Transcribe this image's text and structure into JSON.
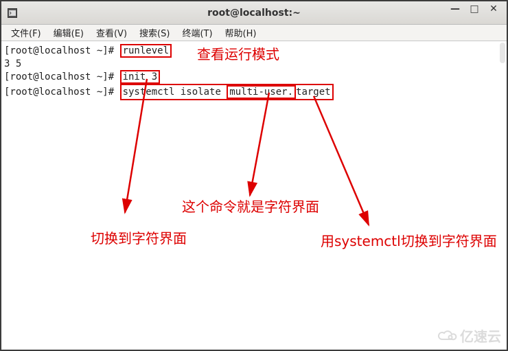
{
  "window": {
    "title": "root@localhost:~",
    "icon": "terminal-icon",
    "buttons": {
      "min": "—",
      "max": "□",
      "close": "✕"
    }
  },
  "menu": {
    "file": "文件(F)",
    "edit": "编辑(E)",
    "view": "查看(V)",
    "search": "搜索(S)",
    "term": "终端(T)",
    "help": "帮助(H)"
  },
  "prompt": "[root@localhost ~]# ",
  "lines": {
    "l1_cmd": "runlevel",
    "l2_out": "3 5",
    "l3_cmd": "init 3",
    "l4_cmd_a": "systemctl isolate ",
    "l4_cmd_b": "multi-user.",
    "l4_cmd_c": "target"
  },
  "annotations": {
    "view_mode": "查看运行模式",
    "char_ui_cmd": "这个命令就是字符界面",
    "switch_char": "切换到字符界面",
    "systemctl_switch": "用systemctl切换到字符界面"
  },
  "colors": {
    "accent": "#d00",
    "titlebar_bg": "#e0ded9",
    "menubar_bg": "#f4f3f1"
  },
  "watermark": "亿速云"
}
